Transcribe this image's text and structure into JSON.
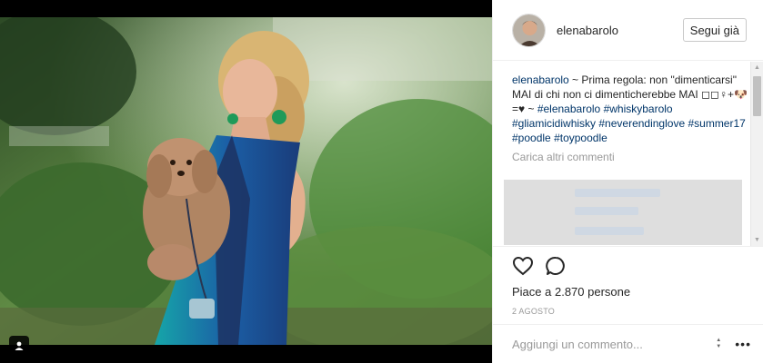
{
  "post": {
    "username": "elenabarolo",
    "follow_label": "Segui già",
    "caption_user": "elenabarolo",
    "caption_text": " ~ Prima regola: non \"dimenticarsi\" MAI di chi non ci dimenticherebbe MAI ◻◻♀+🐶=♥ ~ ",
    "hashtags": [
      "#elenabarolo",
      "#whiskybarolo",
      "#gliamicidiwhisky",
      "#neverendinglove",
      "#summer17",
      "#poodle",
      "#toypoodle"
    ],
    "load_more": "Carica altri commenti",
    "likes": "Piace a 2.870 persone",
    "date": "2 AGOSTO",
    "comment_placeholder": "Aggiungi un commento...",
    "more_label": "•••"
  },
  "icons": {
    "user_tag": "person-tag-icon",
    "like": "heart-outline-icon",
    "comment": "speech-bubble-icon",
    "stepper": "stepper-arrows-icon",
    "more": "ellipsis-icon"
  },
  "colors": {
    "link": "#003569",
    "muted": "#999999",
    "dress_blue": "#1f4f9c",
    "dress_teal": "#1aa3a0"
  }
}
